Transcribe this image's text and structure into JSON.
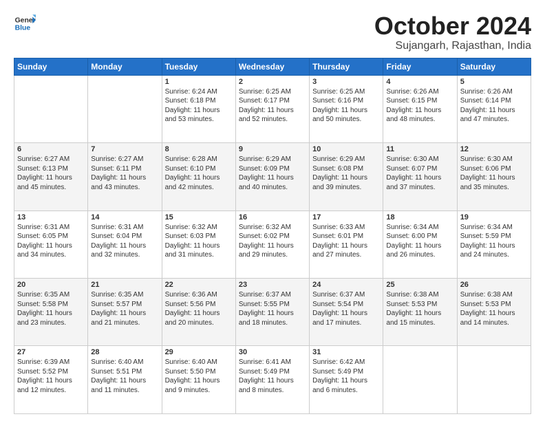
{
  "logo": {
    "line1": "General",
    "line2": "Blue"
  },
  "title": "October 2024",
  "subtitle": "Sujangarh, Rajasthan, India",
  "days": [
    "Sunday",
    "Monday",
    "Tuesday",
    "Wednesday",
    "Thursday",
    "Friday",
    "Saturday"
  ],
  "weeks": [
    [
      {
        "day": "",
        "content": ""
      },
      {
        "day": "",
        "content": ""
      },
      {
        "day": "1",
        "content": "Sunrise: 6:24 AM\nSunset: 6:18 PM\nDaylight: 11 hours and 53 minutes."
      },
      {
        "day": "2",
        "content": "Sunrise: 6:25 AM\nSunset: 6:17 PM\nDaylight: 11 hours and 52 minutes."
      },
      {
        "day": "3",
        "content": "Sunrise: 6:25 AM\nSunset: 6:16 PM\nDaylight: 11 hours and 50 minutes."
      },
      {
        "day": "4",
        "content": "Sunrise: 6:26 AM\nSunset: 6:15 PM\nDaylight: 11 hours and 48 minutes."
      },
      {
        "day": "5",
        "content": "Sunrise: 6:26 AM\nSunset: 6:14 PM\nDaylight: 11 hours and 47 minutes."
      }
    ],
    [
      {
        "day": "6",
        "content": "Sunrise: 6:27 AM\nSunset: 6:13 PM\nDaylight: 11 hours and 45 minutes."
      },
      {
        "day": "7",
        "content": "Sunrise: 6:27 AM\nSunset: 6:11 PM\nDaylight: 11 hours and 43 minutes."
      },
      {
        "day": "8",
        "content": "Sunrise: 6:28 AM\nSunset: 6:10 PM\nDaylight: 11 hours and 42 minutes."
      },
      {
        "day": "9",
        "content": "Sunrise: 6:29 AM\nSunset: 6:09 PM\nDaylight: 11 hours and 40 minutes."
      },
      {
        "day": "10",
        "content": "Sunrise: 6:29 AM\nSunset: 6:08 PM\nDaylight: 11 hours and 39 minutes."
      },
      {
        "day": "11",
        "content": "Sunrise: 6:30 AM\nSunset: 6:07 PM\nDaylight: 11 hours and 37 minutes."
      },
      {
        "day": "12",
        "content": "Sunrise: 6:30 AM\nSunset: 6:06 PM\nDaylight: 11 hours and 35 minutes."
      }
    ],
    [
      {
        "day": "13",
        "content": "Sunrise: 6:31 AM\nSunset: 6:05 PM\nDaylight: 11 hours and 34 minutes."
      },
      {
        "day": "14",
        "content": "Sunrise: 6:31 AM\nSunset: 6:04 PM\nDaylight: 11 hours and 32 minutes."
      },
      {
        "day": "15",
        "content": "Sunrise: 6:32 AM\nSunset: 6:03 PM\nDaylight: 11 hours and 31 minutes."
      },
      {
        "day": "16",
        "content": "Sunrise: 6:32 AM\nSunset: 6:02 PM\nDaylight: 11 hours and 29 minutes."
      },
      {
        "day": "17",
        "content": "Sunrise: 6:33 AM\nSunset: 6:01 PM\nDaylight: 11 hours and 27 minutes."
      },
      {
        "day": "18",
        "content": "Sunrise: 6:34 AM\nSunset: 6:00 PM\nDaylight: 11 hours and 26 minutes."
      },
      {
        "day": "19",
        "content": "Sunrise: 6:34 AM\nSunset: 5:59 PM\nDaylight: 11 hours and 24 minutes."
      }
    ],
    [
      {
        "day": "20",
        "content": "Sunrise: 6:35 AM\nSunset: 5:58 PM\nDaylight: 11 hours and 23 minutes."
      },
      {
        "day": "21",
        "content": "Sunrise: 6:35 AM\nSunset: 5:57 PM\nDaylight: 11 hours and 21 minutes."
      },
      {
        "day": "22",
        "content": "Sunrise: 6:36 AM\nSunset: 5:56 PM\nDaylight: 11 hours and 20 minutes."
      },
      {
        "day": "23",
        "content": "Sunrise: 6:37 AM\nSunset: 5:55 PM\nDaylight: 11 hours and 18 minutes."
      },
      {
        "day": "24",
        "content": "Sunrise: 6:37 AM\nSunset: 5:54 PM\nDaylight: 11 hours and 17 minutes."
      },
      {
        "day": "25",
        "content": "Sunrise: 6:38 AM\nSunset: 5:53 PM\nDaylight: 11 hours and 15 minutes."
      },
      {
        "day": "26",
        "content": "Sunrise: 6:38 AM\nSunset: 5:53 PM\nDaylight: 11 hours and 14 minutes."
      }
    ],
    [
      {
        "day": "27",
        "content": "Sunrise: 6:39 AM\nSunset: 5:52 PM\nDaylight: 11 hours and 12 minutes."
      },
      {
        "day": "28",
        "content": "Sunrise: 6:40 AM\nSunset: 5:51 PM\nDaylight: 11 hours and 11 minutes."
      },
      {
        "day": "29",
        "content": "Sunrise: 6:40 AM\nSunset: 5:50 PM\nDaylight: 11 hours and 9 minutes."
      },
      {
        "day": "30",
        "content": "Sunrise: 6:41 AM\nSunset: 5:49 PM\nDaylight: 11 hours and 8 minutes."
      },
      {
        "day": "31",
        "content": "Sunrise: 6:42 AM\nSunset: 5:49 PM\nDaylight: 11 hours and 6 minutes."
      },
      {
        "day": "",
        "content": ""
      },
      {
        "day": "",
        "content": ""
      }
    ]
  ]
}
